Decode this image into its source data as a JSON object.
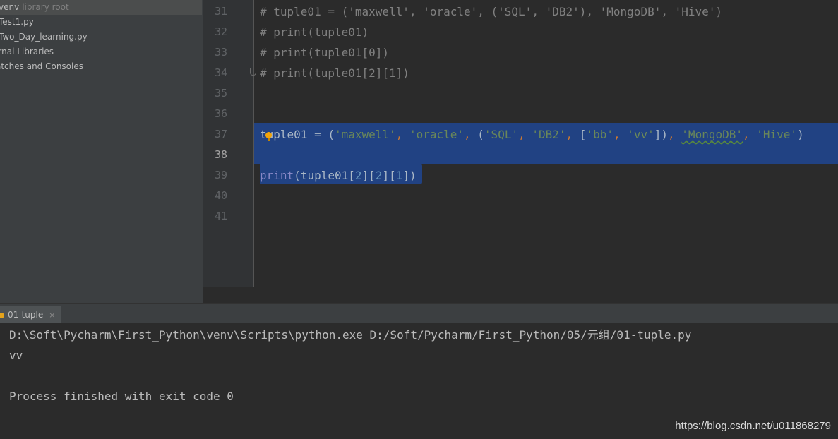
{
  "project_tree": {
    "venv": {
      "name": "venv",
      "annotation": "library root"
    },
    "files": [
      "Test1.py",
      "Two_Day_learning.py"
    ],
    "external_libraries": "ernal Libraries",
    "scratches": "atches and Consoles"
  },
  "editor": {
    "line_numbers": [
      "31",
      "32",
      "33",
      "34",
      "35",
      "36",
      "37",
      "38",
      "39",
      "40",
      "41"
    ],
    "current_line": "38",
    "lines": {
      "l31": "# tuple01 = ('maxwell', 'oracle', ('SQL', 'DB2'), 'MongoDB', 'Hive')",
      "l32": "# print(tuple01)",
      "l33": "# print(tuple01[0])",
      "l34": "# print(tuple01[2][1])",
      "l37_name": "tuple01",
      "l37_eq": " = ",
      "l37_s1": "'maxwell'",
      "l37_s2": "'oracle'",
      "l37_s3": "'SQL'",
      "l37_s4": "'DB2'",
      "l37_s5": "'bb'",
      "l37_s6": "'vv'",
      "l37_s7": "'MongoDB'",
      "l37_s8": "'Hive'",
      "l39_func": "print",
      "l39_name": "tuple01",
      "l39_i1": "2",
      "l39_i2": "2",
      "l39_i3": "1"
    }
  },
  "run_panel": {
    "tab_label": "01-tuple",
    "close_glyph": "×",
    "output": {
      "command": "D:\\Soft\\Pycharm\\First_Python\\venv\\Scripts\\python.exe D:/Soft/Pycharm/First_Python/05/元组/01-tuple.py",
      "result": "vv",
      "exit": "Process finished with exit code 0"
    }
  },
  "watermark": "https://blog.csdn.net/u011868279",
  "colors": {
    "comment": "#808080",
    "string": "#6a8759",
    "keyword": "#cc7832",
    "builtin": "#8888c6",
    "number": "#6897bb",
    "selection": "#214283"
  }
}
